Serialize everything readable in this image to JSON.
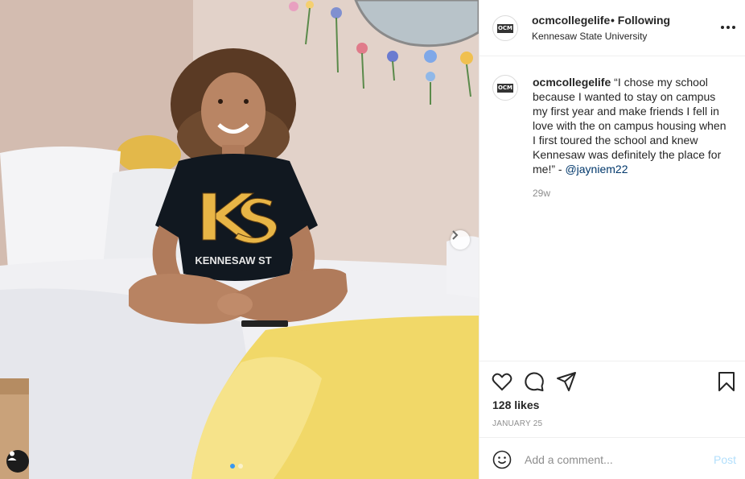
{
  "post": {
    "username": "ocmcollegelife",
    "follow_state": "• Following",
    "location": "Kennesaw State University",
    "avatar_text": "OCM",
    "caption_user": "ocmcollegelife",
    "caption_text": " “I chose my school because I wanted to stay on campus my first year and make friends I fell in love with the on campus housing when I first toured the school and knew Kennesaw was definitely the place for me!” - ",
    "caption_mention": "@jayniem22",
    "time_ago": "29w",
    "likes": "128 likes",
    "date": "JANUARY 25"
  },
  "photo": {
    "shirt_text": "KENNESAW ST",
    "carousel_total": 2,
    "carousel_active": 1
  },
  "comment": {
    "placeholder": "Add a comment...",
    "post_label": "Post"
  },
  "icons": [
    "heart-icon",
    "comment-icon",
    "share-icon",
    "bookmark-icon",
    "emoji-icon",
    "more-options-icon",
    "chevron-right-icon",
    "user-tag-icon"
  ],
  "colors": {
    "link": "#00376b",
    "post_disabled": "#b2dffc",
    "muted": "#8e8e8e",
    "carousel_active": "#3897f0"
  }
}
